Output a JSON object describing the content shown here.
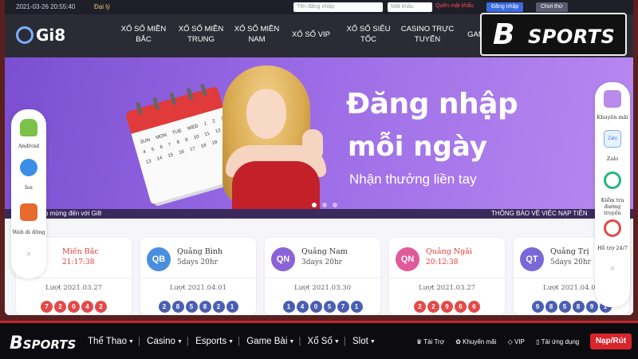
{
  "topbar": {
    "datetime": "2021-03-26 20:55:40",
    "agency": "Đại lý",
    "username_placeholder": "Tên đăng nhập",
    "password_placeholder": "Mật khẩu",
    "forgot_password": "Quên mật khẩu",
    "login_label": "Đăng nhập",
    "try_label": "Chơi thử"
  },
  "nav": {
    "logo": "Gi8",
    "items": [
      {
        "line1": "XỔ SỐ MIỀN",
        "line2": "BẮC"
      },
      {
        "line1": "XỔ SỐ MIỀN",
        "line2": "TRUNG"
      },
      {
        "line1": "XỔ SỐ MIỀN",
        "line2": "NAM"
      },
      {
        "line1": "XỔ SỐ VIP",
        "line2": ""
      },
      {
        "line1": "XỔ SỐ SIÊU",
        "line2": "TỐC"
      },
      {
        "line1": "CASINO TRỰC",
        "line2": "TUYẾN"
      },
      {
        "line1": "GAM",
        "line2": ""
      }
    ]
  },
  "banner": {
    "headline1": "Đăng nhập",
    "headline2": "mỗi ngày",
    "subline": "Nhận thưởng liền tay",
    "calendar_days": "SUN MON TUE WED 1 2 3 4 5 6 7 8 9 10 11 12 13 14 15 16 17 18 19 20",
    "slides_total": 3,
    "slide_active": 1
  },
  "ticker": {
    "left": "o mừng đến với Gi8",
    "right": "THÔNG BÁO VỀ VIỆC NẠP TIỀN"
  },
  "cards": [
    {
      "badge": "",
      "name": "Miền Bắc",
      "sub": "21:17:38",
      "turn": "Lượt 2021.03.27",
      "balls": [
        "7",
        "2",
        "0",
        "4",
        "2"
      ],
      "color": "#e24a4a",
      "text_color": "#e23a3a",
      "sub_color": "#e23a3a"
    },
    {
      "badge": "QB",
      "name": "Quảng Bình",
      "sub": "5days 20hr",
      "turn": "Lượt 2021.04.01",
      "balls": [
        "2",
        "8",
        "5",
        "8",
        "2",
        "1"
      ],
      "color": "#4a6fd8",
      "text_color": "#333",
      "sub_color": "#555"
    },
    {
      "badge": "QN",
      "name": "Quảng Nam",
      "sub": "3days 20hr",
      "turn": "Lượt 2021.03.30",
      "balls": [
        "1",
        "4",
        "0",
        "5",
        "7",
        "1"
      ],
      "color": "#7a58d8",
      "text_color": "#333",
      "sub_color": "#555"
    },
    {
      "badge": "QN",
      "name": "Quảng Ngãi",
      "sub": "20:12:38",
      "turn": "Lượt 2021.03.27",
      "balls": [
        "2",
        "2",
        "9",
        "6",
        "6"
      ],
      "color": "#e04a8a",
      "text_color": "#e23a3a",
      "sub_color": "#e23a3a"
    },
    {
      "badge": "QT",
      "name": "Quảng Trị",
      "sub": "5days 20hr",
      "turn": "Lượt 2021.04.01",
      "balls": [
        "9",
        "8",
        "5",
        "8",
        "9",
        "1"
      ],
      "color": "#5a5ad8",
      "text_color": "#333",
      "sub_color": "#555"
    }
  ],
  "left_sidebar": {
    "android": "Android",
    "ios": "Ios",
    "web": "Web di động",
    "close": "×"
  },
  "right_sidebar": {
    "promo": "Khuyến mãi",
    "zalo_icon_text": "Zalo",
    "zalo": "Zalo",
    "route_check": "Kiểm tra đường truyền",
    "support": "Hỗ trợ 24/7",
    "close": "×"
  },
  "sports_badge": {
    "b": "B",
    "text": "SPORTS"
  },
  "bottom_nav": {
    "logo_b": "B",
    "logo_text": "SPORTS",
    "menu": [
      "Thể Thao",
      "Casino",
      "Esports",
      "Game Bài",
      "Xổ Số",
      "Slot"
    ],
    "right_links": [
      "Tài Trợ",
      "Khuyến mãi",
      "VIP",
      "Tải ứng dụng"
    ],
    "cta": "Nạp/Rút"
  }
}
